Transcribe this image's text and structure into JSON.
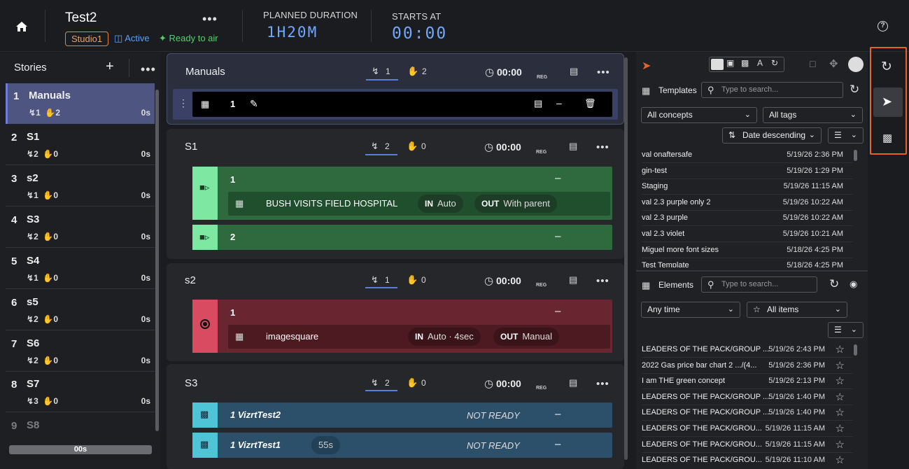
{
  "header": {
    "title": "Test2",
    "studio": "Studio1",
    "status_active": "Active",
    "status_ready": "Ready to air",
    "planned_label": "PLANNED DURATION",
    "planned_value": "1H20M",
    "starts_label": "STARTS AT",
    "starts_value": "00:00"
  },
  "stories_panel": {
    "title": "Stories",
    "footer": "00s",
    "items": [
      {
        "num": "1",
        "name": "Manuals",
        "trig": "1",
        "hand": "2",
        "dur": "0s"
      },
      {
        "num": "2",
        "name": "S1",
        "trig": "2",
        "hand": "0",
        "dur": "0s"
      },
      {
        "num": "3",
        "name": "s2",
        "trig": "1",
        "hand": "0",
        "dur": "0s"
      },
      {
        "num": "4",
        "name": "S3",
        "trig": "2",
        "hand": "0",
        "dur": "0s"
      },
      {
        "num": "5",
        "name": "S4",
        "trig": "1",
        "hand": "0",
        "dur": "0s"
      },
      {
        "num": "6",
        "name": "s5",
        "trig": "2",
        "hand": "0",
        "dur": "0s"
      },
      {
        "num": "7",
        "name": "S6",
        "trig": "2",
        "hand": "0",
        "dur": "0s"
      },
      {
        "num": "8",
        "name": "S7",
        "trig": "3",
        "hand": "0",
        "dur": "0s"
      },
      {
        "num": "9",
        "name": "S8",
        "trig": "",
        "hand": "",
        "dur": ""
      }
    ]
  },
  "rundown": {
    "reg": "REG",
    "manuals": {
      "name": "Manuals",
      "trig": "1",
      "hand": "2",
      "timer": "00:00",
      "row_num": "1"
    },
    "s1": {
      "name": "S1",
      "trig": "2",
      "hand": "0",
      "timer": "00:00",
      "item1": "1",
      "element": "BUSH VISITS FIELD HOSPITAL",
      "in_label": "IN",
      "in_val": "Auto",
      "out_label": "OUT",
      "out_val": "With parent",
      "item2": "2",
      "dash": "–"
    },
    "s2": {
      "name": "s2",
      "trig": "1",
      "hand": "0",
      "timer": "00:00",
      "item1": "1",
      "element": "imagesquare",
      "in_label": "IN",
      "in_val": "Auto · 4sec",
      "out_label": "OUT",
      "out_val": "Manual",
      "dash": "–"
    },
    "s3": {
      "name": "S3",
      "trig": "2",
      "hand": "0",
      "timer": "00:00",
      "item1": "1 VizrtTest2",
      "item1_status": "NOT READY",
      "item2": "1 VizrtTest1",
      "item2_dur": "55s",
      "item2_status": "NOT READY",
      "dash": "–"
    }
  },
  "templates": {
    "title": "Templates",
    "search_placeholder": "Type to search...",
    "concepts": "All concepts",
    "tags": "All tags",
    "sort": "Date descending",
    "rows": [
      {
        "name": "val onaftersafe",
        "date": "5/19/26 2:36 PM"
      },
      {
        "name": "gin-test",
        "date": "5/19/26 1:29 PM"
      },
      {
        "name": "Staging",
        "date": "5/19/26 11:15 AM"
      },
      {
        "name": "val 2.3 purple only 2",
        "date": "5/19/26 10:22 AM"
      },
      {
        "name": "val 2.3 purple",
        "date": "5/19/26 10:22 AM"
      },
      {
        "name": "val 2.3 violet",
        "date": "5/19/26 10:21 AM"
      },
      {
        "name": "Miguel more font sizes",
        "date": "5/18/26 4:25 PM"
      },
      {
        "name": "Test Template",
        "date": "5/18/26 4:25 PM"
      }
    ]
  },
  "elements": {
    "title": "Elements",
    "search_placeholder": "Type to search...",
    "time": "Any time",
    "items": "All items",
    "rows": [
      {
        "name": "LEADERS OF THE PACK/GROUP ...",
        "date": "5/19/26 2:43 PM"
      },
      {
        "name": "2022 Gas price bar chart 2 .../(4...",
        "date": "5/19/26 2:36 PM"
      },
      {
        "name": "I am THE green concept",
        "date": "5/19/26 2:13 PM"
      },
      {
        "name": "LEADERS OF THE PACK/GROUP ...",
        "date": "5/19/26 1:40 PM"
      },
      {
        "name": "LEADERS OF THE PACK/GROUP ...",
        "date": "5/19/26 1:40 PM"
      },
      {
        "name": "LEADERS OF THE PACK/GROU...",
        "date": "5/19/26 11:15 AM"
      },
      {
        "name": "LEADERS OF THE PACK/GROU...",
        "date": "5/19/26 11:15 AM"
      },
      {
        "name": "LEADERS OF THE PACK/GROU...",
        "date": "5/19/26 11:10 AM"
      }
    ]
  },
  "colors": {
    "accent": "#5a7fd6",
    "green_block": "#2f6a3f",
    "red_block": "#6a2630",
    "blue_block": "#2c4f6a",
    "highlight_border": "#e8632a"
  }
}
